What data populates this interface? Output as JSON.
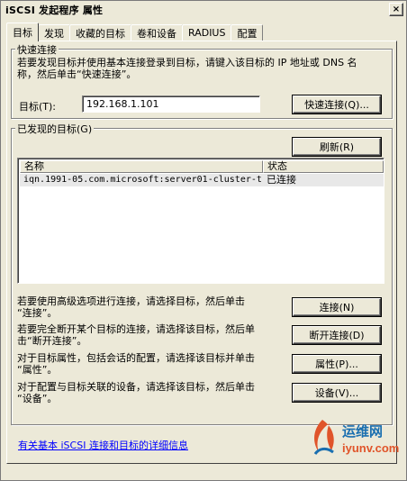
{
  "window": {
    "title": "iSCSI 发起程序 属性",
    "close_symbol": "×"
  },
  "tabs": [
    {
      "label": "目标",
      "active": true
    },
    {
      "label": "发现",
      "active": false
    },
    {
      "label": "收藏的目标",
      "active": false
    },
    {
      "label": "卷和设备",
      "active": false
    },
    {
      "label": "RADIUS",
      "active": false
    },
    {
      "label": "配置",
      "active": false
    }
  ],
  "quick_connect": {
    "group_label": "快速连接",
    "description": "若要发现目标并使用基本连接登录到目标，请键入该目标的 IP 地址或 DNS 名\n称，然后单击“快速连接”。",
    "target_label": "目标(T):",
    "target_value": "192.168.1.101",
    "button_label": "快速连接(Q)..."
  },
  "discovered": {
    "group_label": "已发现的目标(G)",
    "refresh_label": "刷新(R)",
    "columns": [
      "名称",
      "状态"
    ],
    "rows": [
      {
        "name": "iqn.1991-05.com.microsoft:server01-cluster-t...",
        "status": "已连接"
      }
    ]
  },
  "actions": [
    {
      "desc": "若要使用高级选项进行连接，请选择目标，然后单击\n“连接”。",
      "button": "连接(N)"
    },
    {
      "desc": "若要完全断开某个目标的连接，请选择该目标，然后单\n击“断开连接”。",
      "button": "断开连接(D)"
    },
    {
      "desc": "对于目标属性，包括会话的配置，请选择该目标并单击\n“属性”。",
      "button": "属性(P)..."
    },
    {
      "desc": "对于配置与目标关联的设备，请选择该目标，然后单击\n“设备”。",
      "button": "设备(V)..."
    }
  ],
  "help_link": "有关基本 iSCSI 连接和目标的详细信息",
  "watermark": {
    "line1": "运维网",
    "line2": "iyunv.com"
  }
}
